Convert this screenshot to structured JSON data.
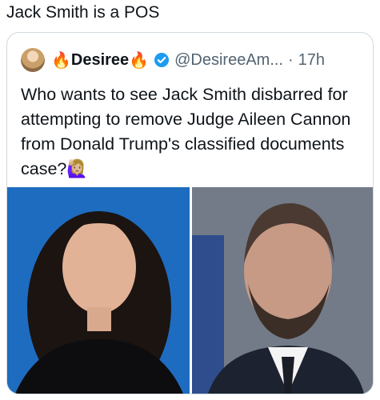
{
  "post": {
    "text": "Jack Smith is a POS"
  },
  "quote": {
    "display_name_prefix": "🔥",
    "display_name": "Desiree",
    "display_name_suffix": "🔥",
    "handle": "@DesireeAm...",
    "separator": "·",
    "time": "17h",
    "text": "Who wants to see Jack Smith disbarred for attempting to remove Judge Aileen Cannon from Donald Trump's classified documents case?🙋🏼‍♀️"
  },
  "colors": {
    "verified_badge": "#1d9bf0",
    "secondary_text": "#536471",
    "border": "#cfd9de"
  }
}
